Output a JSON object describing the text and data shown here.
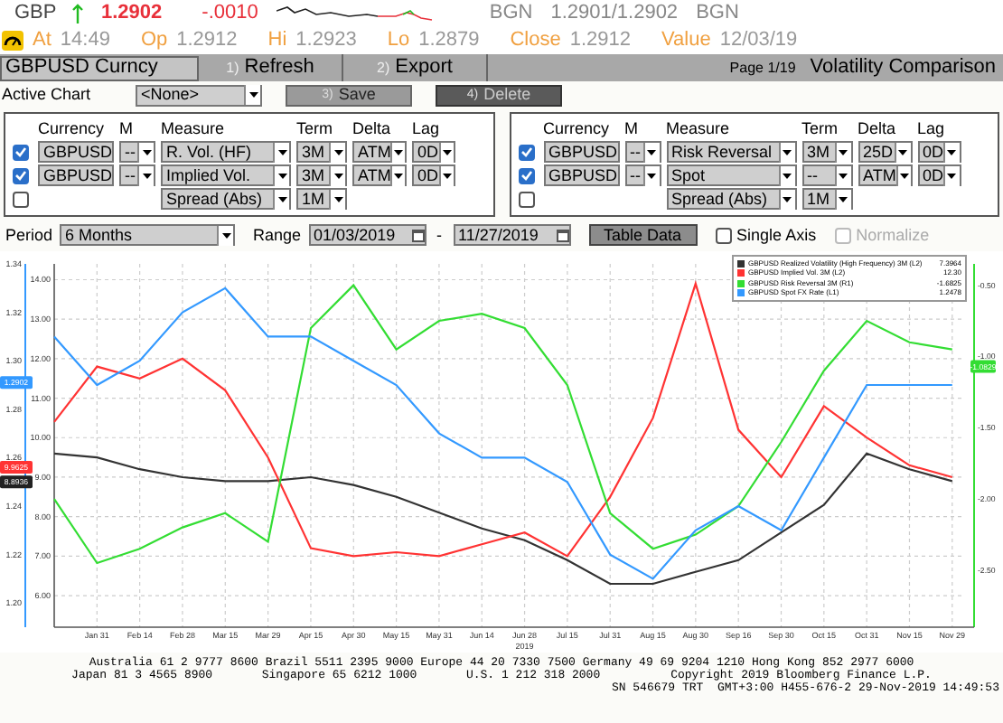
{
  "quote": {
    "ticker": "GBP",
    "up": true,
    "last": "1.2902",
    "change": "-.0010",
    "bid_source": "BGN",
    "bid_ask": "1.2901/1.2902",
    "ask_source": "BGN"
  },
  "quote_details": [
    {
      "label": "At",
      "value": "14:49"
    },
    {
      "label": "Op",
      "value": "1.2912"
    },
    {
      "label": "Hi",
      "value": "1.2923"
    },
    {
      "label": "Lo",
      "value": "1.2879"
    },
    {
      "label": "Close",
      "value": "1.2912"
    },
    {
      "label": "Value",
      "value": "12/03/19"
    }
  ],
  "toolbar": {
    "security": "GBPUSD Curncy",
    "buttons": [
      {
        "key": "1)",
        "label": "Refresh"
      },
      {
        "key": "2)",
        "label": "Export"
      }
    ],
    "page": "Page 1/19",
    "title": "Volatility Comparison"
  },
  "active_chart": {
    "label": "Active Chart",
    "value": "<None>",
    "buttons": [
      {
        "key": "3)",
        "label": "Save",
        "kind": "light"
      },
      {
        "key": "4)",
        "label": "Delete",
        "kind": "dark"
      }
    ]
  },
  "panels": [
    {
      "columns": [
        "Currency",
        "M",
        "Measure",
        "Term",
        "Delta",
        "Lag"
      ],
      "rows": [
        {
          "checked": true,
          "currency": "GBPUSD",
          "m": "--",
          "measure": "R. Vol. (HF)",
          "term": "3M",
          "delta": "ATM",
          "lag": "0D"
        },
        {
          "checked": true,
          "currency": "GBPUSD",
          "m": "--",
          "measure": "Implied Vol.",
          "term": "3M",
          "delta": "ATM",
          "lag": "0D"
        },
        {
          "checked": false,
          "measure": "Spread (Abs)",
          "term": "1M"
        }
      ]
    },
    {
      "columns": [
        "Currency",
        "M",
        "Measure",
        "Term",
        "Delta",
        "Lag"
      ],
      "rows": [
        {
          "checked": true,
          "currency": "GBPUSD",
          "m": "--",
          "measure": "Risk Reversal",
          "term": "3M",
          "delta": "25D",
          "lag": "0D"
        },
        {
          "checked": true,
          "currency": "GBPUSD",
          "m": "--",
          "measure": "Spot",
          "term": "--",
          "delta": "ATM",
          "lag": "0D"
        },
        {
          "checked": false,
          "measure": "Spread (Abs)",
          "term": "1M"
        }
      ]
    }
  ],
  "period": {
    "label": "Period",
    "value": "6 Months"
  },
  "range": {
    "label": "Range",
    "start": "01/03/2019",
    "separator": "-",
    "end": "11/27/2019"
  },
  "table_button": "Table Data",
  "options": [
    {
      "label": "Single Axis",
      "checked": false,
      "disabled": false
    },
    {
      "label": "Normalize",
      "checked": false,
      "disabled": true
    }
  ],
  "chart": {
    "chart_data": {
      "type": "line",
      "categories": [
        null,
        "Jan 31",
        "Feb 14",
        "Feb 28",
        "Mar 15",
        "Mar 29",
        "Apr 15",
        "Apr 30",
        "May 15",
        "May 31",
        "Jun 14",
        "Jun 28",
        "Jul 15",
        "Jul 31",
        "Aug 15",
        "Aug 30",
        "Sep 16",
        "Sep 30",
        "Oct 15",
        "Oct 31",
        "Nov 15",
        "Nov 29"
      ],
      "xlabel": "2019",
      "grid": true,
      "ylim": [
        5.2,
        14.4
      ],
      "yticks": [
        {
          "value": 14,
          "label": "14.00"
        },
        {
          "value": 13,
          "label": "13.00"
        },
        {
          "value": 12,
          "label": "12.00"
        },
        {
          "value": 11,
          "label": "11.00"
        },
        {
          "value": 10,
          "label": "10.00"
        },
        {
          "value": 9,
          "label": "9.00"
        },
        {
          "value": 8,
          "label": "8.00"
        },
        {
          "value": 7,
          "label": "7.00"
        },
        {
          "value": 6,
          "label": "6.00"
        }
      ],
      "y2lim": [
        1.19,
        1.34
      ],
      "y2ticks": [
        {
          "value": 1.34,
          "label": "1.34"
        },
        {
          "value": 1.32,
          "label": "1.32"
        },
        {
          "value": 1.3,
          "label": "1.30"
        },
        {
          "value": 1.28,
          "label": "1.28"
        },
        {
          "value": 1.26,
          "label": "1.26"
        },
        {
          "value": 1.24,
          "label": "1.24"
        },
        {
          "value": 1.22,
          "label": "1.22"
        },
        {
          "value": 1.2,
          "label": "1.20"
        }
      ],
      "y3lim": [
        -2.9,
        -0.35
      ],
      "y3ticks": [
        {
          "value": -0.5,
          "label": "-0.50"
        },
        {
          "value": -1,
          "label": "-1.00"
        },
        {
          "value": -1.5,
          "label": "-1.50"
        },
        {
          "value": -2,
          "label": "-2.00"
        },
        {
          "value": -2.5,
          "label": "-2.50"
        }
      ],
      "series": [
        {
          "name": "GBPUSD Realized Volatility (High Frequency) 3M (L2)",
          "color": "#333333",
          "values": [
            9.6,
            9.5,
            9.2,
            9.0,
            8.9,
            8.9,
            9.0,
            8.8,
            8.5,
            8.1,
            7.7,
            7.4,
            6.9,
            6.3,
            6.3,
            6.6,
            6.9,
            7.6,
            8.3,
            9.6,
            9.2,
            8.9
          ]
        },
        {
          "name": "GBPUSD Implied Vol. 3M (L2)",
          "color": "#ff3333",
          "values": [
            10.4,
            11.8,
            11.5,
            12.0,
            11.2,
            9.5,
            7.2,
            7.0,
            7.1,
            7.0,
            7.3,
            7.6,
            7.0,
            8.5,
            10.5,
            13.9,
            10.2,
            9.0,
            10.8,
            10.0,
            9.3,
            9.0
          ]
        },
        {
          "name": "GBPUSD Risk Reversal 3M (R1)",
          "color": "#33dd33",
          "axis": "y3",
          "values": [
            -2.0,
            -2.45,
            -2.35,
            -2.2,
            -2.1,
            -2.3,
            -0.8,
            -0.5,
            -0.95,
            -0.75,
            -0.7,
            -0.8,
            -1.2,
            -2.1,
            -2.35,
            -2.25,
            -2.05,
            -1.6,
            -1.1,
            -0.75,
            -0.9,
            -0.95
          ]
        },
        {
          "name": "GBPUSD Spot FX Rate (L1)",
          "color": "#3399ff",
          "axis": "y2",
          "values": [
            1.31,
            1.29,
            1.3,
            1.32,
            1.33,
            1.31,
            1.31,
            1.3,
            1.29,
            1.27,
            1.26,
            1.26,
            1.25,
            1.22,
            1.21,
            1.23,
            1.24,
            1.23,
            1.26,
            1.29,
            1.29,
            1.29
          ]
        }
      ]
    },
    "legend_values": [
      "7.3964",
      "12.30",
      "-1.6825",
      "1.2478"
    ],
    "badges": [
      {
        "text": "1.2902",
        "color": "#3399ff"
      },
      {
        "text": "9.9625",
        "color": "#ff3333"
      },
      {
        "text": "8.8936",
        "color": "#222222"
      },
      {
        "text": "-1.0829",
        "color": "#33dd33"
      }
    ]
  },
  "footer": [
    "Australia 61 2 9777 8600 Brazil 5511 2395 9000 Europe 44 20 7330 7500 Germany 49 69 9204 1210 Hong Kong 852 2977 6000",
    "Japan 81 3 4565 8900       Singapore 65 6212 1000       U.S. 1 212 318 2000          Copyright 2019 Bloomberg Finance L.P.",
    "SN 546679 TRT  GMT+3:00 H455-676-2 29-Nov-2019 14:49:53"
  ]
}
